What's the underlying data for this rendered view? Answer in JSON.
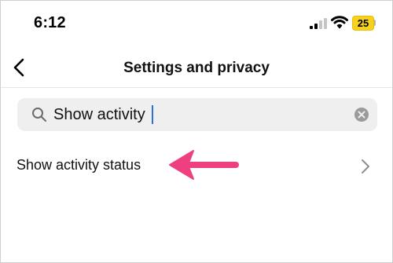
{
  "status_bar": {
    "time": "6:12",
    "battery_level": "25",
    "icons": [
      "cellular-signal-icon",
      "wifi-icon",
      "battery-icon"
    ]
  },
  "header": {
    "title": "Settings and privacy",
    "back_icon": "chevron-left-icon"
  },
  "search": {
    "value": "Show activity",
    "icon": "search-icon",
    "clear_icon": "clear-circle-icon"
  },
  "results": [
    {
      "label": "Show activity status",
      "icon": "chevron-right-icon"
    }
  ],
  "colors": {
    "battery": "#f7d21d",
    "annotation_arrow": "#ee3f80",
    "caret": "#2f6fd6",
    "search_background": "#efefef"
  }
}
